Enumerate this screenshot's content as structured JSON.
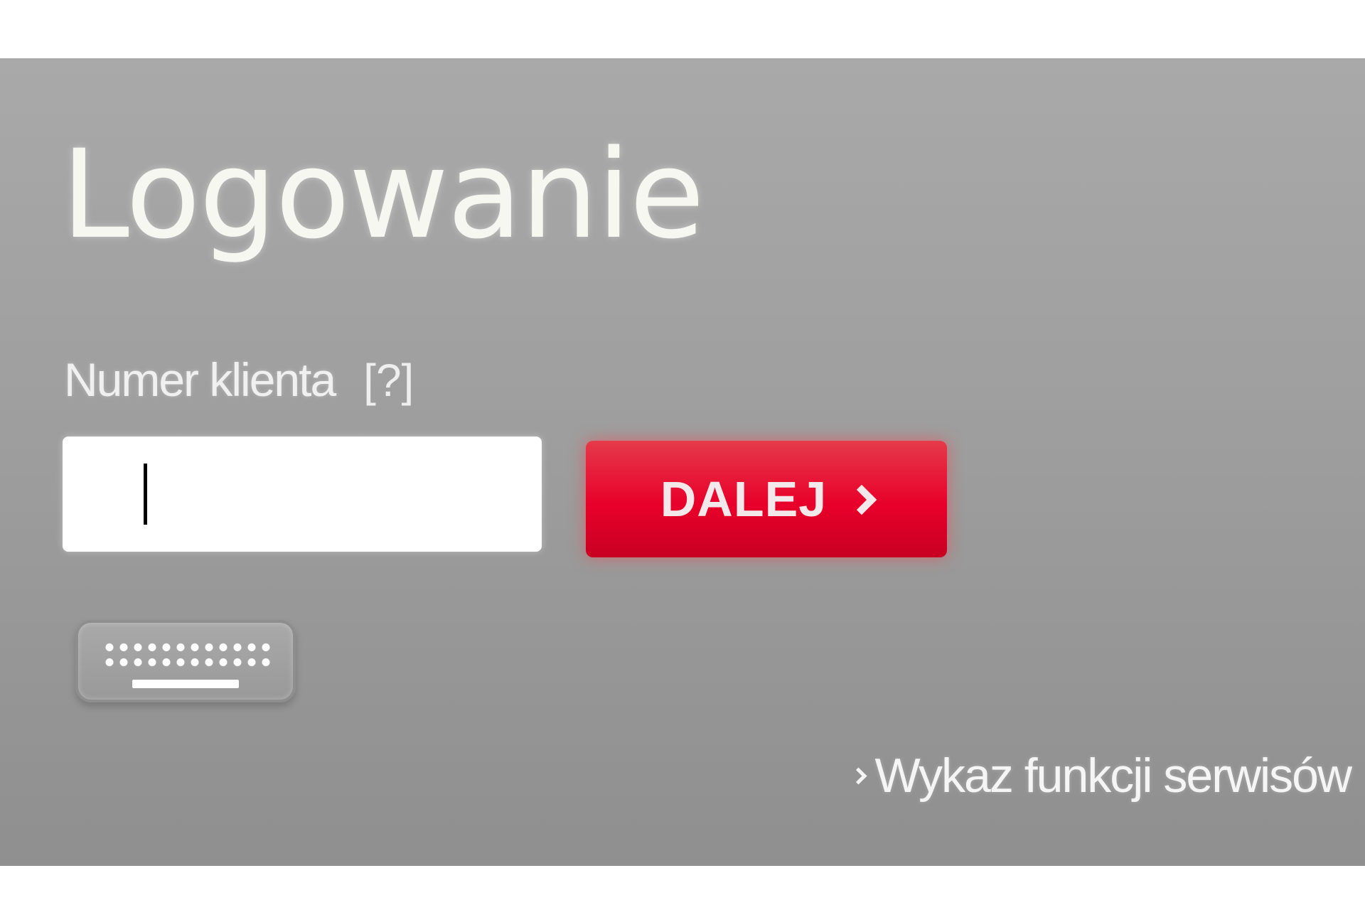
{
  "login": {
    "title": "Logowanie",
    "client_number_label": "Numer klienta",
    "help_label": "[?]",
    "client_number_value": "",
    "client_number_placeholder": "",
    "next_button_label": "DALEJ",
    "next_button_icon": "chevron-right-icon",
    "virtual_keyboard_icon": "keyboard-icon",
    "services_link_label": "Wykaz funkcji serwisów",
    "services_link_icon": "chevron-right-icon"
  },
  "colors": {
    "panel_background": "#9d9d9d",
    "button_red": "#e8002a",
    "text_light": "#f5f5f5",
    "page_background": "#ffffff"
  }
}
